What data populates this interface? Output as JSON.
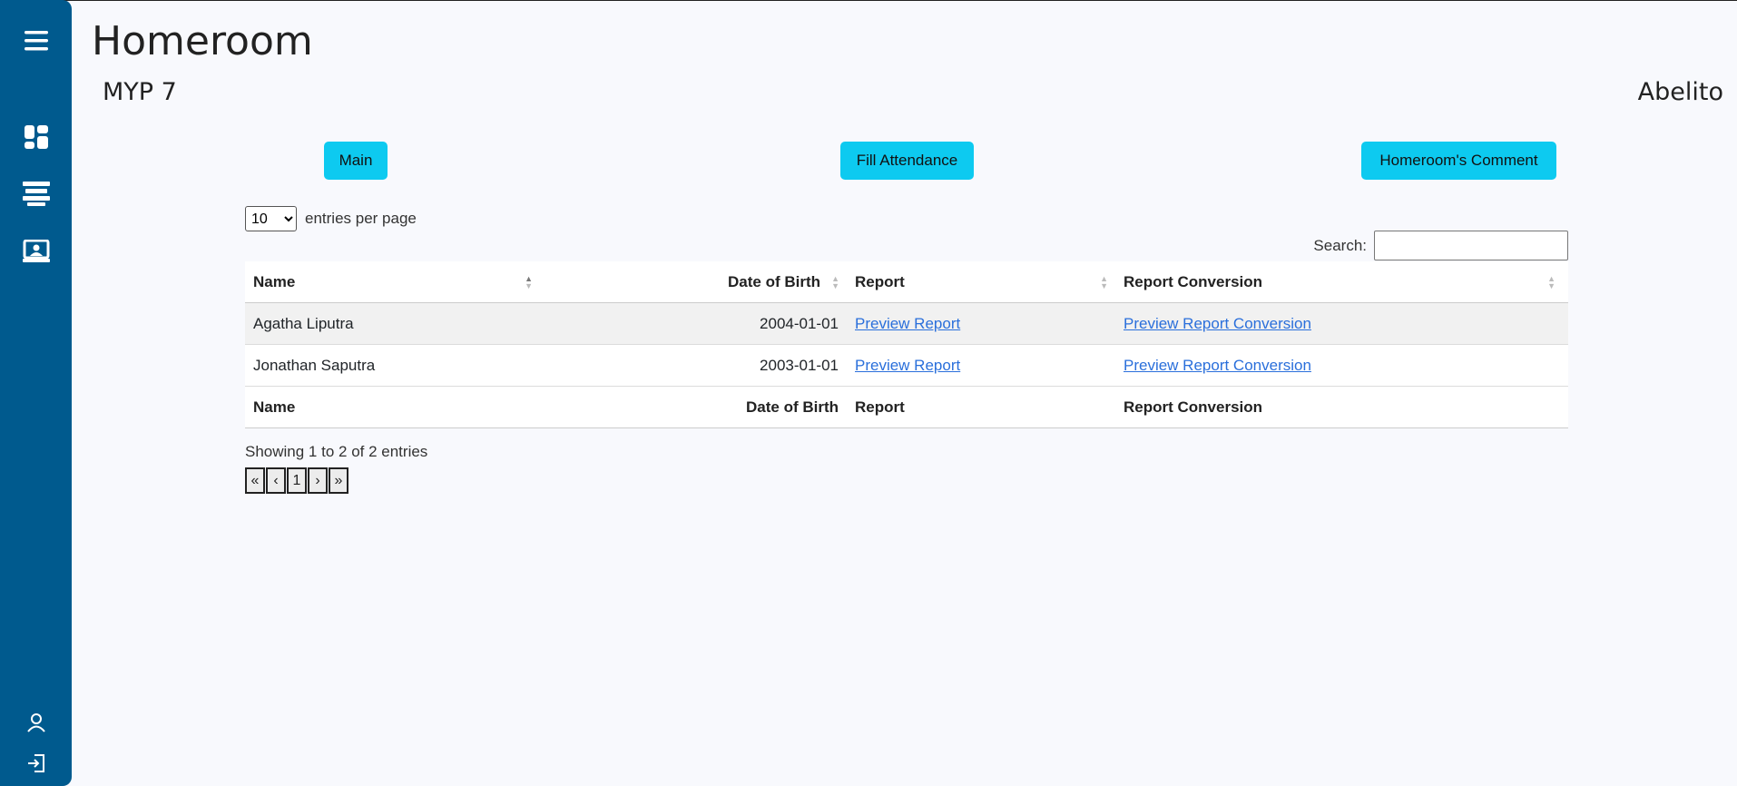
{
  "header": {
    "title": "Homeroom",
    "class_name": "MYP 7",
    "user_name": "Abelito"
  },
  "sidebar": {
    "top_icons": [
      "menu-icon",
      "dashboard-icon",
      "classes-icon",
      "homeroom-icon"
    ],
    "bottom_icons": [
      "profile-icon",
      "logout-icon"
    ]
  },
  "actions": {
    "main": "Main",
    "fill_attendance": "Fill Attendance",
    "homeroom_comment": "Homeroom's Comment"
  },
  "table_controls": {
    "length_value": "10",
    "length_label": "entries per page",
    "search_label": "Search:",
    "search_value": ""
  },
  "table": {
    "columns": [
      "Name",
      "Date of Birth",
      "Report",
      "Report Conversion"
    ],
    "rows": [
      {
        "name": "Agatha Liputra",
        "dob": "2004-01-01",
        "report": "Preview Report",
        "conversion": "Preview Report Conversion"
      },
      {
        "name": "Jonathan Saputra",
        "dob": "2003-01-01",
        "report": "Preview Report",
        "conversion": "Preview Report Conversion"
      }
    ]
  },
  "footer": {
    "info": "Showing 1 to 2 of 2 entries",
    "pager": [
      "«",
      "‹",
      "1",
      "›",
      "»"
    ]
  },
  "colors": {
    "sidebar": "#005a8e",
    "button": "#0dcaf0",
    "link": "#2a6fdb"
  }
}
